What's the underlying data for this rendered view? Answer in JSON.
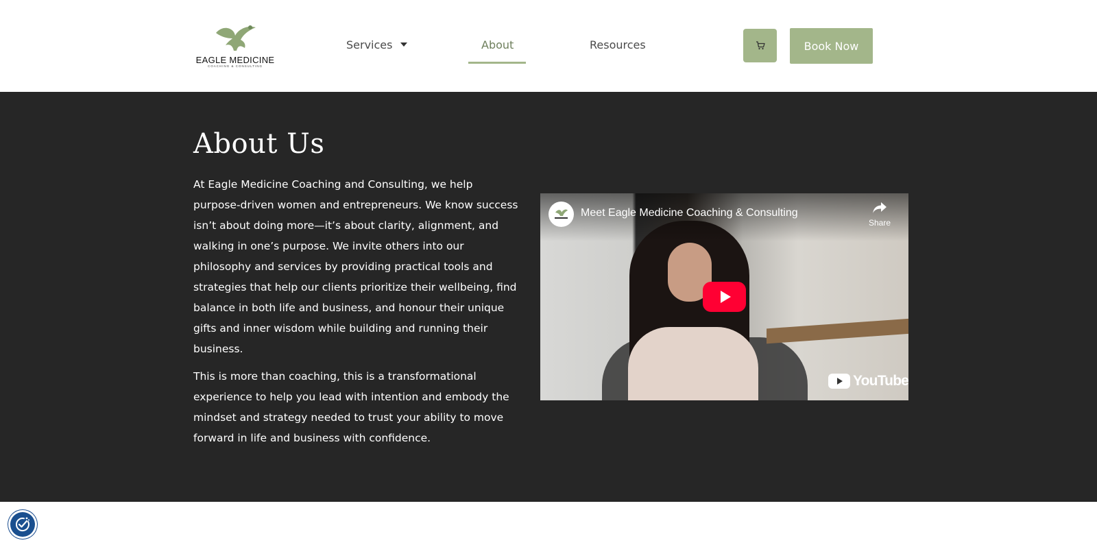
{
  "header": {
    "logo": {
      "wordmark": "EAGLE MEDICINE",
      "tagline": "COACHING & CONSULTING",
      "icon": "eagle-icon"
    },
    "nav": [
      {
        "label": "Services",
        "has_dropdown": true,
        "active": false
      },
      {
        "label": "About",
        "active": true
      },
      {
        "label": "Resources",
        "active": false
      }
    ],
    "cart": {
      "icon": "cart-icon"
    },
    "book_now_label": "Book Now"
  },
  "about": {
    "title": "About Us",
    "paragraphs": [
      "At Eagle Medicine Coaching and Consulting, we help purpose-driven women and entrepreneurs. We know success isn’t about doing more—it’s about clarity, alignment, and walking in one’s purpose. We invite others into our philosophy and services by providing practical tools and strategies that help our clients prioritize their wellbeing, find balance in both life and business, and honour their unique gifts and inner wisdom while building and running their business.",
      "This is more than coaching, this is a transformational experience to help you lead with intention and embody the mindset and strategy needed to trust your ability to move forward in life and business with confidence."
    ],
    "video": {
      "title": "Meet Eagle Medicine Coaching & Consulting",
      "share_label": "Share",
      "brand": "YouTube",
      "play_icon": "play-icon"
    }
  },
  "accessibility": {
    "icon": "accessibility-icon"
  },
  "colors": {
    "accent": "#a3b68a",
    "nav_active": "#6e7f5c",
    "section_bg": "#262626",
    "play_red": "#ff0033",
    "a11y_blue": "#1a4f8f"
  }
}
